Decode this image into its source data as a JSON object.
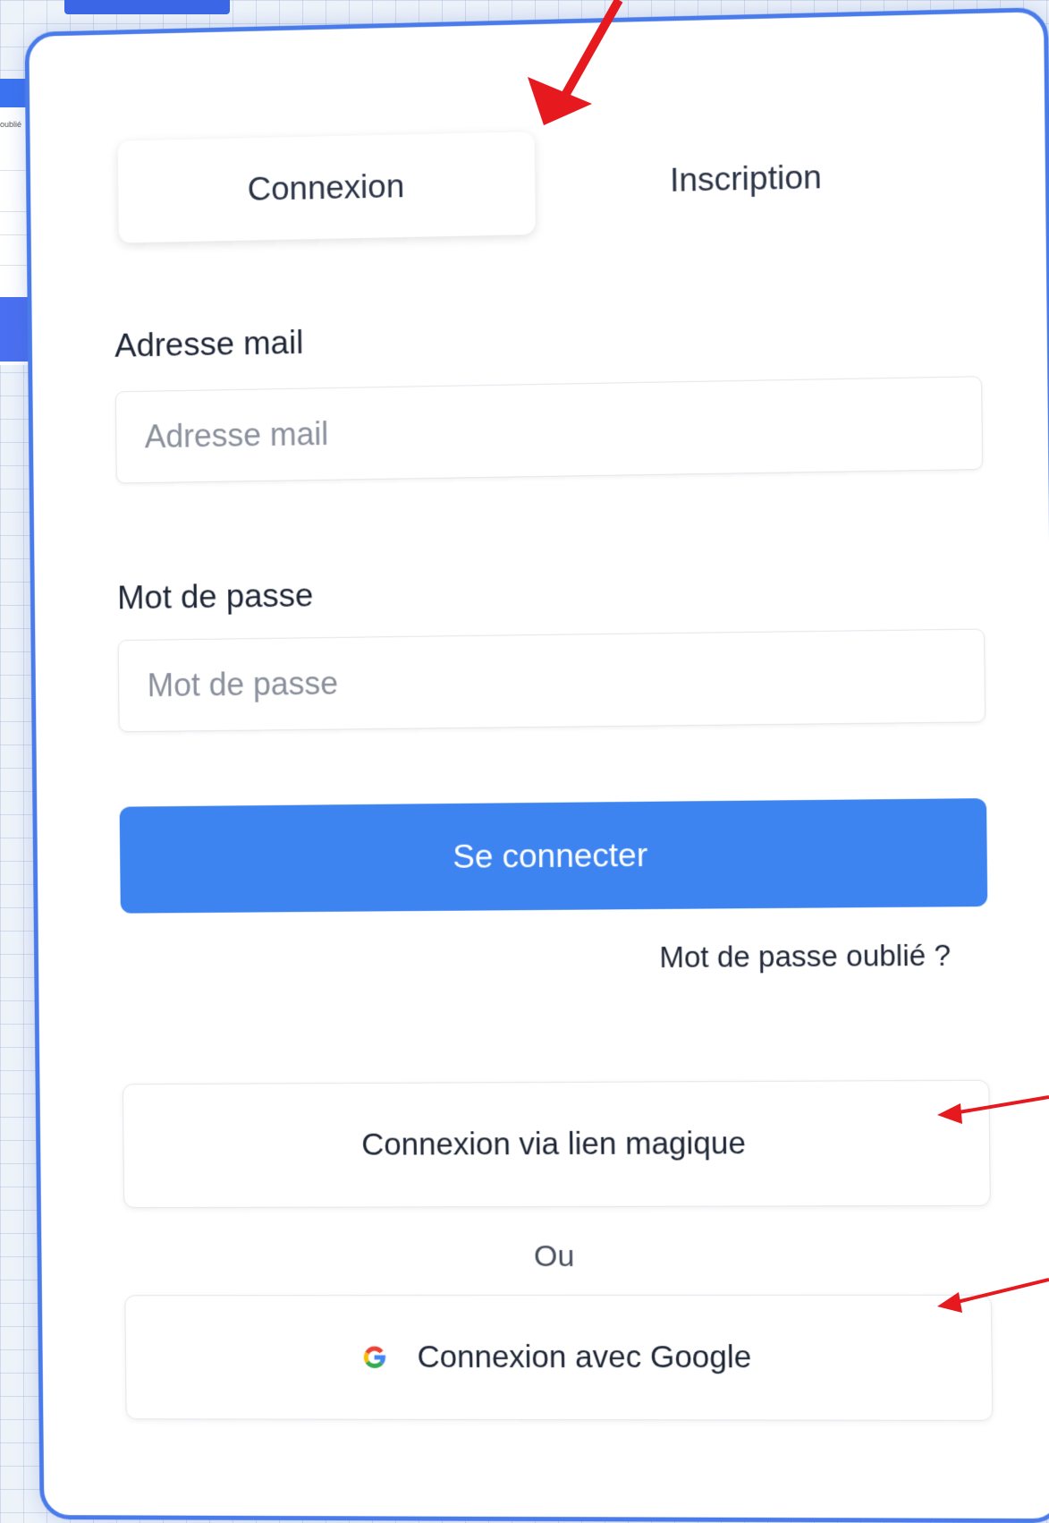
{
  "auth": {
    "tabs": [
      {
        "label": "Connexion",
        "active": true
      },
      {
        "label": "Inscription",
        "active": false
      }
    ],
    "email": {
      "label": "Adresse mail",
      "placeholder": "Adresse mail"
    },
    "password": {
      "label": "Mot de passe",
      "placeholder": "Mot de passe"
    },
    "submit_label": "Se connecter",
    "forgot_label": "Mot de passe oublié ?",
    "magic_link_label": "Connexion via lien magique",
    "separator_label": "Ou",
    "google_label": "Connexion avec Google"
  },
  "background": {
    "panel_fragment_text": "oublié"
  },
  "colors": {
    "accent": "#3d84f1",
    "card_border": "#4a7bea",
    "annotation_arrow": "#e6191f"
  },
  "icons": {
    "google": "google-icon",
    "annotation": "arrow-annotation-icon"
  }
}
